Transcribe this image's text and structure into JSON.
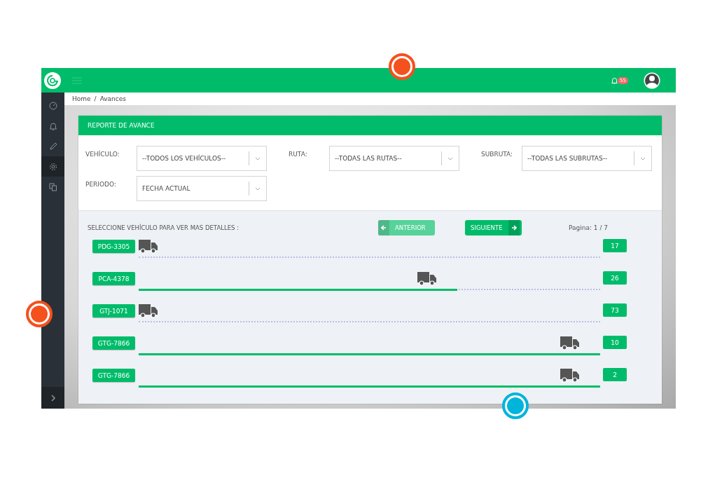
{
  "topbar": {
    "notifications": {
      "count": "55"
    }
  },
  "sidebar": {
    "items": [
      {
        "kind": "gauge",
        "selected": false
      },
      {
        "kind": "bell",
        "selected": false
      },
      {
        "kind": "pencil",
        "selected": false
      },
      {
        "kind": "gear",
        "selected": true
      },
      {
        "kind": "copy",
        "selected": false
      }
    ]
  },
  "breadcrumb": [
    {
      "label": "Home"
    },
    {
      "label": "Avances"
    }
  ],
  "breadcrumb_separator": "/",
  "card": {
    "title": "REPORTE DE AVANCE",
    "filters": [
      {
        "label": "VEHÍCULO:",
        "value": "--TODOS LOS VEHÍCULOS--"
      },
      {
        "label": "RUTA:",
        "value": "--TODAS LAS RUTAS--"
      },
      {
        "label": "SUBRUTA:",
        "value": "--TODAS LAS SUBRUTAS--"
      },
      {
        "label": "PERIODO:",
        "value": "FECHA ACTUAL"
      }
    ],
    "instruction": "SELECCIONE VEHÍCULO PARA VER MAS DETALLES :",
    "pager": {
      "previous": {
        "label": "ANTERIOR",
        "disabled": true
      },
      "next": {
        "label": "SIGUIENTE",
        "disabled": false
      },
      "page": "Pagina: 1 / 7"
    },
    "vehicles": [
      {
        "plate": "PDG-3305",
        "count": "17",
        "level": 0
      },
      {
        "plate": "PCA-4378",
        "count": "26",
        "level": 0.69
      },
      {
        "plate": "GTJ-1071",
        "count": "73",
        "level": 0
      },
      {
        "plate": "GTG-7866",
        "count": "10",
        "level": 1
      },
      {
        "plate": "GTG-7866",
        "count": "2",
        "level": 1
      }
    ]
  },
  "hotspots": [
    {
      "color": "#f4511e"
    },
    {
      "color": "#f4511e"
    },
    {
      "color": "#00b4db"
    }
  ]
}
